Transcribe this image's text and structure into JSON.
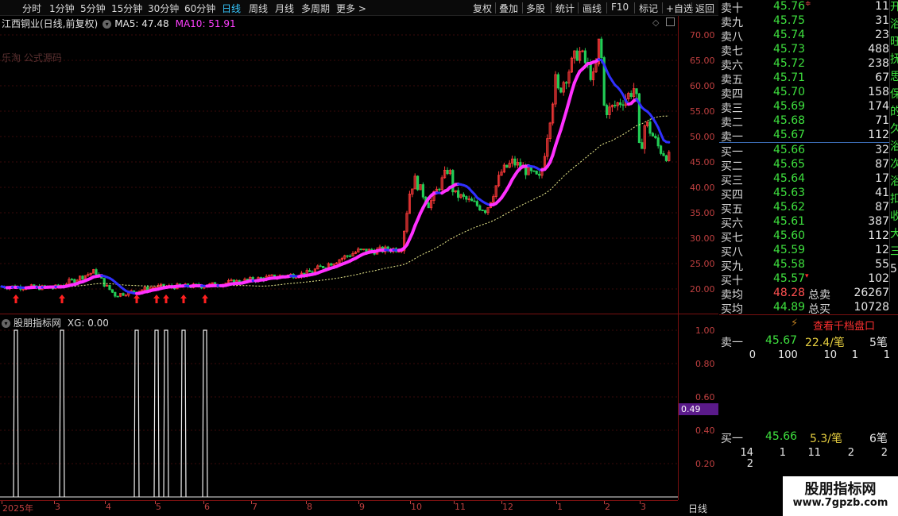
{
  "toolbar": {
    "items": [
      "分时",
      "1分钟",
      "5分钟",
      "15分钟",
      "30分钟",
      "60分钟",
      "日线",
      "周线",
      "月线",
      "多周期",
      "更多 >"
    ],
    "active_index": 6,
    "right_items": [
      "复权",
      "叠加",
      "多股",
      "统计",
      "画线",
      "F10",
      "标记",
      "+自选",
      "返回"
    ]
  },
  "chart": {
    "stock_title": "江西铜业(日线,前复权)",
    "ma5": "MA5: 47.48",
    "ma10": "MA10: 51.91",
    "watermark": "乐淘 公式源码",
    "y_labels": [
      "70.00",
      "65.00",
      "60.00",
      "55.00",
      "50.00",
      "45.00",
      "40.00",
      "35.00",
      "30.00",
      "25.00",
      "20.00"
    ]
  },
  "indicator": {
    "title": "股朋指标网",
    "xg": "XG: 0.00",
    "y_labels": [
      "1.00",
      "0.80",
      "0.60",
      "0.40",
      "0.20"
    ],
    "current_value": "0.49"
  },
  "dates": [
    "2025年",
    "3",
    "4",
    "5",
    "6",
    "7",
    "8",
    "9",
    "10",
    "11",
    "12",
    "1",
    "2",
    "3"
  ],
  "period": "日线",
  "chart_data": {
    "type": "candlestick",
    "title": "江西铜业(日线,前复权)",
    "ylim": [
      18,
      72
    ],
    "approx_close_path": [
      [
        "2025年",
        20.5
      ],
      [
        "3",
        20.2
      ],
      [
        "4",
        20.8
      ],
      [
        "5",
        20.4
      ],
      [
        "6",
        20.6
      ],
      [
        "7",
        21.8
      ],
      [
        "8",
        23.0
      ],
      [
        "9",
        27.5
      ],
      [
        "10",
        39.5
      ],
      [
        "11",
        38.5
      ],
      [
        "12",
        43.0
      ],
      [
        "1",
        62.0
      ],
      [
        "2",
        56.0
      ],
      [
        "3",
        46.0
      ]
    ],
    "signal_markers": 8
  },
  "orderbook": {
    "sell": [
      {
        "label": "卖十",
        "price": "45.76",
        "vol": "11",
        "mark": "≑"
      },
      {
        "label": "卖九",
        "price": "45.75",
        "vol": "31"
      },
      {
        "label": "卖八",
        "price": "45.74",
        "vol": "23"
      },
      {
        "label": "卖七",
        "price": "45.73",
        "vol": "488"
      },
      {
        "label": "卖六",
        "price": "45.72",
        "vol": "238"
      },
      {
        "label": "卖五",
        "price": "45.71",
        "vol": "67"
      },
      {
        "label": "卖四",
        "price": "45.70",
        "vol": "158"
      },
      {
        "label": "卖三",
        "price": "45.69",
        "vol": "174"
      },
      {
        "label": "卖二",
        "price": "45.68",
        "vol": "71"
      },
      {
        "label": "卖一",
        "price": "45.67",
        "vol": "112"
      }
    ],
    "buy": [
      {
        "label": "买一",
        "price": "45.66",
        "vol": "32"
      },
      {
        "label": "买二",
        "price": "45.65",
        "vol": "87"
      },
      {
        "label": "买三",
        "price": "45.64",
        "vol": "17"
      },
      {
        "label": "买四",
        "price": "45.63",
        "vol": "41"
      },
      {
        "label": "买五",
        "price": "45.62",
        "vol": "87"
      },
      {
        "label": "买六",
        "price": "45.61",
        "vol": "387"
      },
      {
        "label": "买七",
        "price": "45.60",
        "vol": "112"
      },
      {
        "label": "买八",
        "price": "45.59",
        "vol": "12"
      },
      {
        "label": "买九",
        "price": "45.58",
        "vol": "55"
      },
      {
        "label": "买十",
        "price": "45.57",
        "vol": "102",
        "mark": "▾"
      }
    ],
    "sell_avg_label": "卖均",
    "sell_avg": "48.28",
    "total_sell_label": "总卖",
    "total_sell": "26267",
    "buy_avg_label": "买均",
    "buy_avg": "44.89",
    "total_buy_label": "总买",
    "total_buy": "10728",
    "right_cut_chars": [
      "开",
      "浴",
      "旺",
      "抚",
      "思",
      "保",
      "的",
      "久",
      "浴",
      "次",
      "浴",
      "扣",
      "收",
      "大",
      "三",
      "5"
    ],
    "qiandang": "查看千档盘口",
    "queue_sell": {
      "label": "卖一",
      "price": "45.67",
      "avg": "22.4/笔",
      "count": "5笔",
      "orders": [
        "0",
        "100",
        "10",
        "1",
        "1"
      ]
    },
    "queue_buy": {
      "label": "买一",
      "price": "45.66",
      "avg": "5.3/笔",
      "count": "6笔",
      "orders": [
        "14",
        "1",
        "11",
        "2",
        "2"
      ],
      "orders2": [
        "2"
      ]
    }
  },
  "brand": {
    "name": "股朋指标网",
    "url": "www.7gpzb.com"
  }
}
